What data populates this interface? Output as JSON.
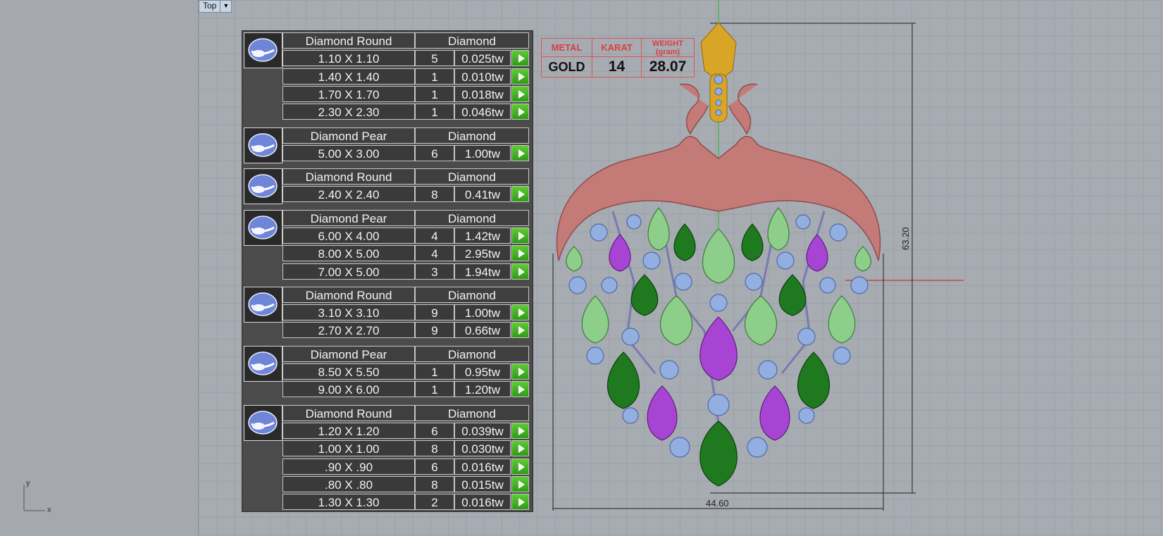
{
  "viewport": {
    "name": "Top",
    "axis_y": "y",
    "axis_x": "x"
  },
  "info_box": {
    "headers": {
      "metal": "METAL",
      "karat": "KARAT",
      "weight": "WEIGHT",
      "weight_unit": "(gram)"
    },
    "values": {
      "metal": "GOLD",
      "karat": "14",
      "weight": "28.07"
    }
  },
  "dimensions": {
    "height": "63.20",
    "width": "44.60"
  },
  "stone_groups": [
    {
      "name": "Diamond Round",
      "material": "Diamond",
      "rows": [
        {
          "size": "1.10 X 1.10",
          "qty": "5",
          "weight": "0.025tw"
        },
        {
          "size": "1.40 X 1.40",
          "qty": "1",
          "weight": "0.010tw"
        },
        {
          "size": "1.70 X 1.70",
          "qty": "1",
          "weight": "0.018tw"
        },
        {
          "size": "2.30 X 2.30",
          "qty": "1",
          "weight": "0.046tw"
        }
      ]
    },
    {
      "name": "Diamond Pear",
      "material": "Diamond",
      "rows": [
        {
          "size": "5.00 X 3.00",
          "qty": "6",
          "weight": "1.00tw"
        }
      ]
    },
    {
      "name": "Diamond Round",
      "material": "Diamond",
      "rows": [
        {
          "size": "2.40 X 2.40",
          "qty": "8",
          "weight": "0.41tw"
        }
      ]
    },
    {
      "name": "Diamond Pear",
      "material": "Diamond",
      "rows": [
        {
          "size": "6.00 X 4.00",
          "qty": "4",
          "weight": "1.42tw"
        },
        {
          "size": "8.00 X 5.00",
          "qty": "4",
          "weight": "2.95tw"
        },
        {
          "size": "7.00 X 5.00",
          "qty": "3",
          "weight": "1.94tw"
        }
      ]
    },
    {
      "name": "Diamond Round",
      "material": "Diamond",
      "rows": [
        {
          "size": "3.10 X 3.10",
          "qty": "9",
          "weight": "1.00tw"
        },
        {
          "size": "2.70 X 2.70",
          "qty": "9",
          "weight": "0.66tw"
        }
      ]
    },
    {
      "name": "Diamond Pear",
      "material": "Diamond",
      "rows": [
        {
          "size": "8.50 X 5.50",
          "qty": "1",
          "weight": "0.95tw"
        },
        {
          "size": "9.00 X 6.00",
          "qty": "1",
          "weight": "1.20tw"
        }
      ]
    },
    {
      "name": "Diamond Round",
      "material": "Diamond",
      "rows": [
        {
          "size": "1.20 X 1.20",
          "qty": "6",
          "weight": "0.039tw"
        },
        {
          "size": "1.00 X 1.00",
          "qty": "8",
          "weight": "0.030tw"
        },
        {
          "size": ".90 X .90",
          "qty": "6",
          "weight": "0.016tw"
        },
        {
          "size": ".80 X .80",
          "qty": "8",
          "weight": "0.015tw"
        },
        {
          "size": "1.30 X 1.30",
          "qty": "2",
          "weight": "0.016tw"
        }
      ]
    }
  ],
  "colors": {
    "gold": "#d8a526",
    "rose_metal": "#c47b78",
    "diamond": "#93aee0",
    "green_dark": "#1f7a1f",
    "green_light": "#8dcf8a",
    "purple": "#a844d4"
  }
}
